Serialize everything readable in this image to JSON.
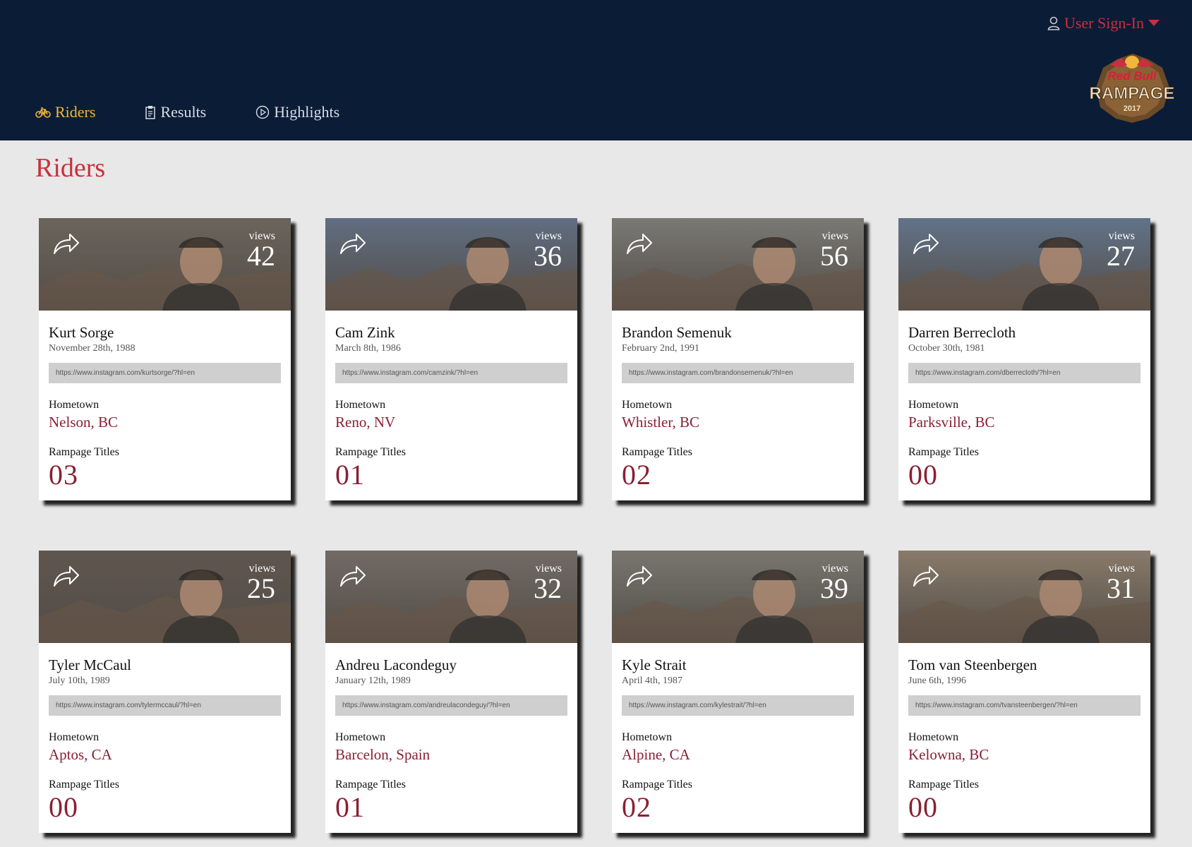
{
  "header": {
    "signin_label": "User Sign-In",
    "logo_line1": "Red Bull",
    "logo_line2": "RAMPAGE",
    "logo_year": "2017",
    "colors": {
      "background": "#0b1c36",
      "accent": "#c8303f",
      "active": "#f2b63c"
    }
  },
  "nav": [
    {
      "label": "Riders",
      "icon": "bike-icon",
      "active": true
    },
    {
      "label": "Results",
      "icon": "clipboard-icon",
      "active": false
    },
    {
      "label": "Highlights",
      "icon": "play-circle-icon",
      "active": false
    }
  ],
  "page": {
    "title": "Riders"
  },
  "labels": {
    "views": "views",
    "hometown": "Hometown",
    "titles": "Rampage Titles"
  },
  "riders": [
    {
      "name": "Kurt Sorge",
      "dob": "November 28th, 1988",
      "url": "https://www.instagram.com/kurtsorge/?hl=en",
      "hometown": "Nelson, BC",
      "titles": "03",
      "views": "42",
      "photo_color": "#7a7266"
    },
    {
      "name": "Cam Zink",
      "dob": "March 8th, 1986",
      "url": "https://www.instagram.com/camzink/?hl=en",
      "hometown": "Reno, NV",
      "titles": "01",
      "views": "36",
      "photo_color": "#6d7f99"
    },
    {
      "name": "Brandon Semenuk",
      "dob": "February 2nd, 1991",
      "url": "https://www.instagram.com/brandonsemenuk/?hl=en",
      "hometown": "Whistler, BC",
      "titles": "02",
      "views": "56",
      "photo_color": "#8f8e88"
    },
    {
      "name": "Darren Berrecloth",
      "dob": "October 30th, 1981",
      "url": "https://www.instagram.com/dberrecloth/?hl=en",
      "hometown": "Parksville, BC",
      "titles": "00",
      "views": "27",
      "photo_color": "#6f86a3"
    },
    {
      "name": "Tyler McCaul",
      "dob": "July 10th, 1989",
      "url": "https://www.instagram.com/tylermccaul/?hl=en",
      "hometown": "Aptos, CA",
      "titles": "00",
      "views": "25",
      "photo_color": "#6b5f55"
    },
    {
      "name": "Andreu Lacondeguy",
      "dob": "January 12th, 1989",
      "url": "https://www.instagram.com/andreulacondeguy/?hl=en",
      "hometown": "Barcelon, Spain",
      "titles": "01",
      "views": "32",
      "photo_color": "#847a74"
    },
    {
      "name": "Kyle Strait",
      "dob": "April 4th, 1987",
      "url": "https://www.instagram.com/kylestrait/?hl=en",
      "hometown": "Alpine, CA",
      "titles": "02",
      "views": "39",
      "photo_color": "#8c8a80"
    },
    {
      "name": "Tom van Steenbergen",
      "dob": "June 6th, 1996",
      "url": "https://www.instagram.com/tvansteenbergen/?hl=en",
      "hometown": "Kelowna, BC",
      "titles": "00",
      "views": "31",
      "photo_color": "#a3907a"
    }
  ]
}
